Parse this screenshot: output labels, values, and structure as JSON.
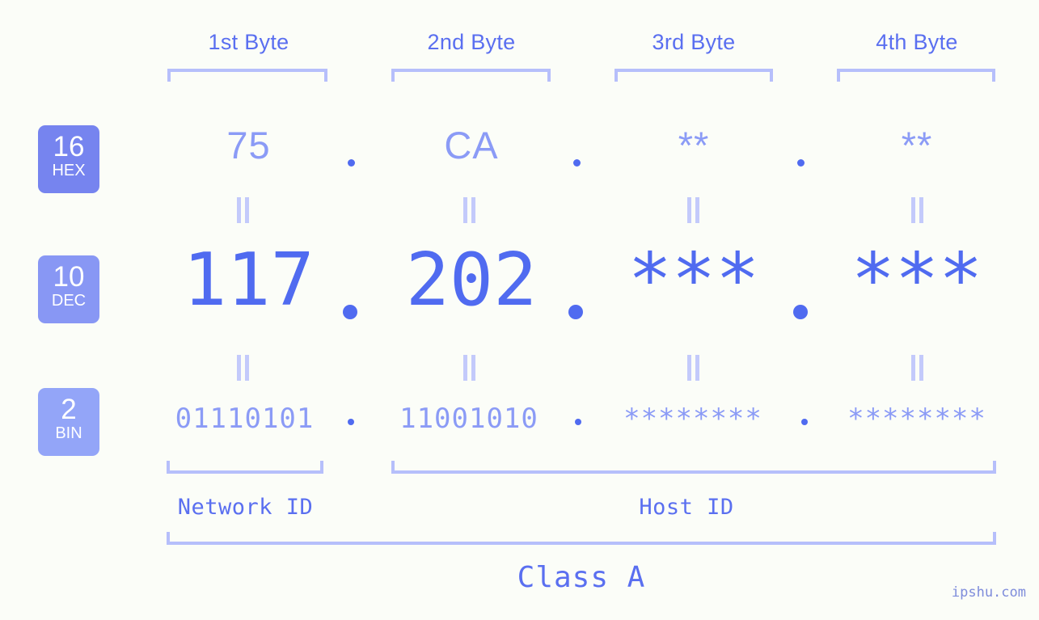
{
  "page": {
    "background_color": "#fbfdf8",
    "accent_color": "#506bf0",
    "accent_light_color": "#8b9bf6",
    "bracket_color": "#b6bffb"
  },
  "header": {
    "bytes": [
      {
        "label": "1st Byte"
      },
      {
        "label": "2nd Byte"
      },
      {
        "label": "3rd Byte"
      },
      {
        "label": "4th Byte"
      }
    ]
  },
  "radix_badges": [
    {
      "number": "16",
      "word": "HEX",
      "color": "#7684ef"
    },
    {
      "number": "10",
      "word": "DEC",
      "color": "#8897f4"
    },
    {
      "number": "2",
      "word": "BIN",
      "color": "#93a5f8"
    }
  ],
  "rows": {
    "hex": {
      "values": [
        "75",
        "CA",
        "**",
        "**"
      ],
      "separators": [
        ".",
        ".",
        "."
      ]
    },
    "dec": {
      "values": [
        "117",
        "202",
        "***",
        "***"
      ],
      "separators": [
        ".",
        ".",
        "."
      ]
    },
    "bin": {
      "values": [
        "01110101",
        "11001010",
        "********",
        "********"
      ],
      "separators": [
        ".",
        ".",
        "."
      ]
    }
  },
  "equals_symbol": "||",
  "segments": {
    "network_id": "Network ID",
    "host_id": "Host ID"
  },
  "class": {
    "label": "Class A"
  },
  "watermark": {
    "text": "ipshu.com"
  }
}
